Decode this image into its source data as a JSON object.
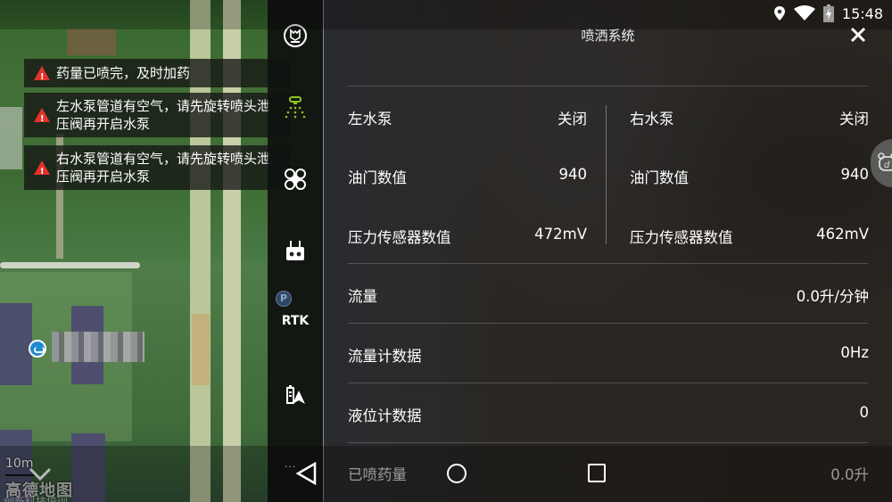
{
  "status_bar": {
    "time": "15:48",
    "icons": [
      "location-icon",
      "wifi-icon",
      "battery-charging-icon"
    ]
  },
  "map": {
    "scale_label": "10m",
    "provider_logo": "高德地图",
    "provider_sub": "创新科技培训",
    "collapse_icon": "chevron-down-icon",
    "poi_icon": "poi-marker-icon"
  },
  "warnings": [
    {
      "icon": "warning-icon",
      "text": "药量已喷完，及时加药"
    },
    {
      "icon": "warning-icon",
      "text": "左水泵管道有空气，请先旋转喷头泄压阀再开启水泵"
    },
    {
      "icon": "warning-icon",
      "text": "右水泵管道有空气，请先旋转喷头泄压阀再开启水泵"
    }
  ],
  "toolbar": {
    "items": [
      {
        "name": "mode-icon",
        "active": false
      },
      {
        "name": "spray-system-icon",
        "active": true
      },
      {
        "name": "drone-icon",
        "active": false
      },
      {
        "name": "remote-controller-icon",
        "active": false
      },
      {
        "name": "rtk",
        "label": "RTK",
        "badge": "P"
      },
      {
        "name": "battery-gps-icon",
        "active": false
      }
    ],
    "active_color": "#8dc21f"
  },
  "panel": {
    "title": "喷洒系统",
    "left_pump": {
      "label": "左水泵",
      "value": "关闭",
      "throttle_label": "油门数值",
      "throttle_value": "940",
      "pressure_label": "压力传感器数值",
      "pressure_value": "472mV"
    },
    "right_pump": {
      "label": "右水泵",
      "value": "关闭",
      "throttle_label": "油门数值",
      "throttle_value": "940",
      "pressure_label": "压力传感器数值",
      "pressure_value": "462mV"
    },
    "rows": [
      {
        "label": "流量",
        "value": "0.0升/分钟"
      },
      {
        "label": "流量计数据",
        "value": "0Hz"
      },
      {
        "label": "液位计数据",
        "value": "0"
      },
      {
        "label": "已喷药量",
        "value": "0.0升"
      }
    ]
  },
  "navbar": {
    "back": "back-icon",
    "home": "home-icon",
    "recents": "recents-icon",
    "more": "..."
  }
}
